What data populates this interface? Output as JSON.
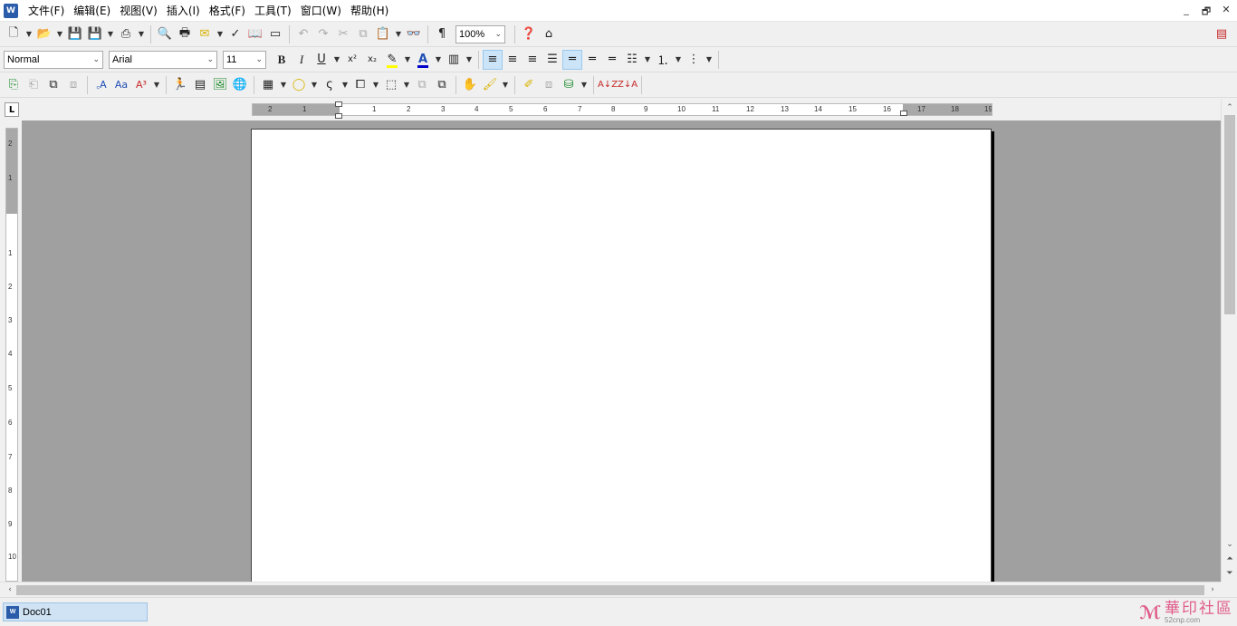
{
  "menus": [
    "文件(F)",
    "编辑(E)",
    "视图(V)",
    "插入(I)",
    "格式(F)",
    "工具(T)",
    "窗口(W)",
    "帮助(H)"
  ],
  "app_icon_text": "W",
  "window_controls": [
    "_",
    "🗗",
    "✕"
  ],
  "toolbar1": {
    "zoom": "100%"
  },
  "toolbar2": {
    "style": "Normal",
    "font": "Arial",
    "size": "11",
    "bold": "B",
    "italic": "I",
    "underline": "U"
  },
  "ruler": {
    "tab_selector": "L",
    "h_numbers": [
      "2",
      "1",
      "1",
      "2",
      "3",
      "4",
      "5",
      "6",
      "7",
      "8",
      "9",
      "10",
      "11",
      "12",
      "13",
      "14",
      "15",
      "16",
      "17",
      "18",
      "19"
    ],
    "v_numbers": [
      "2",
      "1",
      "1",
      "2",
      "3",
      "4",
      "5",
      "6",
      "7",
      "8",
      "9",
      "10"
    ]
  },
  "document": {
    "tab_label": "Doc01"
  },
  "watermark": {
    "name": "華印社區",
    "url": "52cnp.com"
  },
  "colors": {
    "highlight": "#ffff00",
    "font_color": "#0000cc",
    "active_button": "#cce4f7"
  }
}
